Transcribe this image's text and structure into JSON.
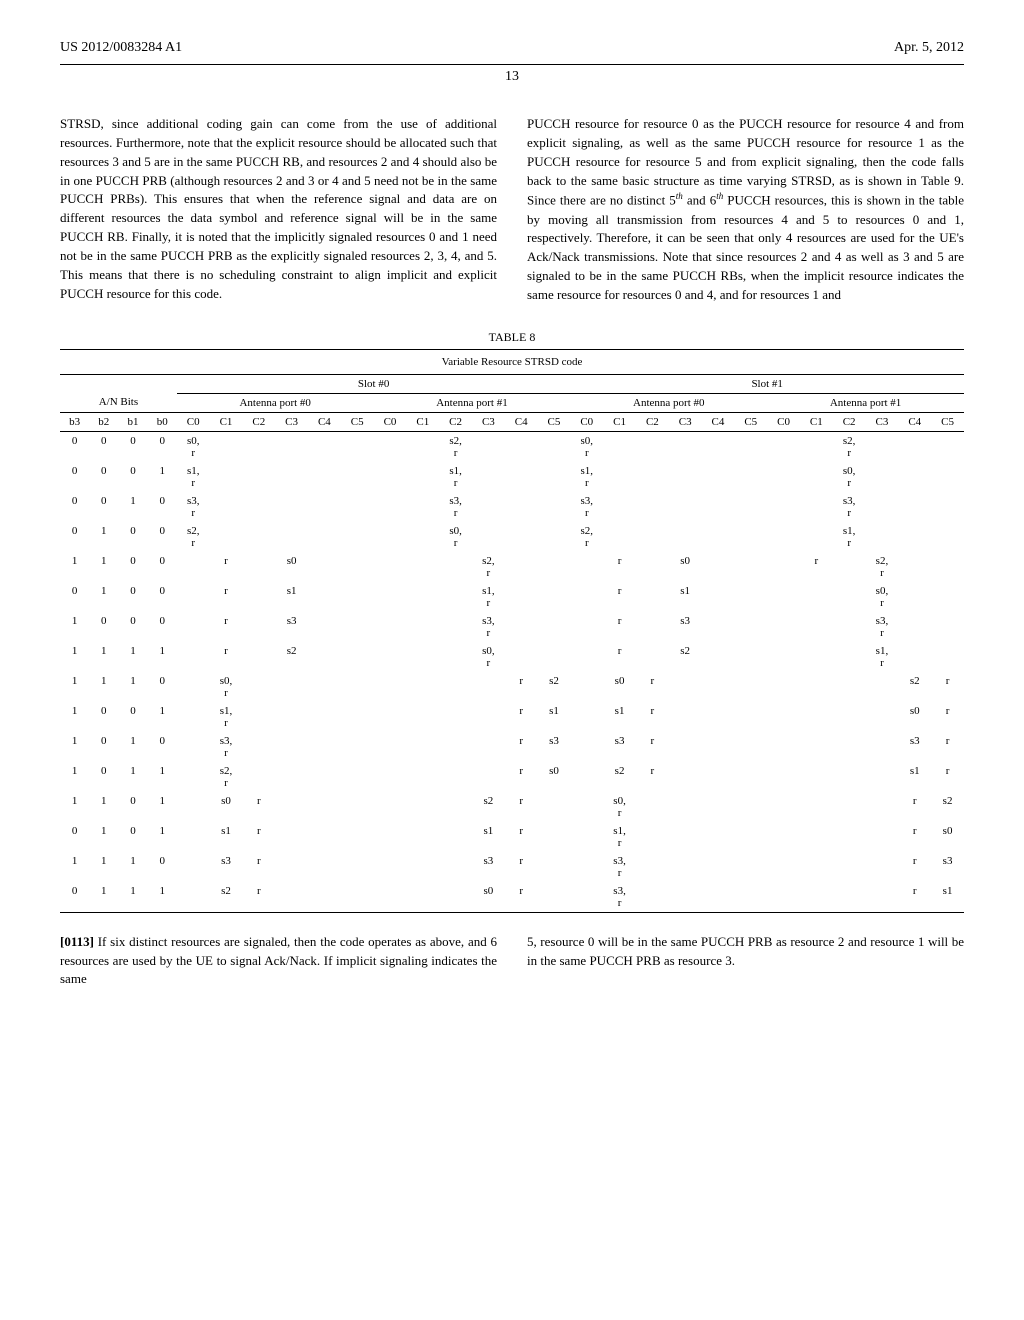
{
  "header": {
    "pub_number": "US 2012/0083284 A1",
    "date": "Apr. 5, 2012",
    "page": "13"
  },
  "chart_data": {
    "type": "table",
    "title": "Variable Resource STRSD code",
    "table_number": "TABLE 8",
    "column_headers": {
      "an_bits": "A/N Bits",
      "bits": [
        "b3",
        "b2",
        "b1",
        "b0"
      ],
      "slots": [
        "Slot #0",
        "Slot #1"
      ],
      "ports": [
        "Antenna port #0",
        "Antenna port #1"
      ],
      "channels": [
        "C0",
        "C1",
        "C2",
        "C3",
        "C4",
        "C5"
      ]
    },
    "rows": [
      {
        "bits": [
          "0",
          "0",
          "0",
          "0"
        ],
        "s0p0": [
          "s0, r",
          "",
          "",
          "",
          "",
          ""
        ],
        "s0p1": [
          "",
          "",
          "s2, r",
          "",
          "",
          ""
        ],
        "s1p0": [
          "s0, r",
          "",
          "",
          "",
          "",
          ""
        ],
        "s1p1": [
          "",
          "",
          "s2, r",
          "",
          "",
          ""
        ]
      },
      {
        "bits": [
          "0",
          "0",
          "0",
          "1"
        ],
        "s0p0": [
          "s1, r",
          "",
          "",
          "",
          "",
          ""
        ],
        "s0p1": [
          "",
          "",
          "s1, r",
          "",
          "",
          ""
        ],
        "s1p0": [
          "s1, r",
          "",
          "",
          "",
          "",
          ""
        ],
        "s1p1": [
          "",
          "",
          "s0, r",
          "",
          "",
          ""
        ]
      },
      {
        "bits": [
          "0",
          "0",
          "1",
          "0"
        ],
        "s0p0": [
          "s3, r",
          "",
          "",
          "",
          "",
          ""
        ],
        "s0p1": [
          "",
          "",
          "s3, r",
          "",
          "",
          ""
        ],
        "s1p0": [
          "s3, r",
          "",
          "",
          "",
          "",
          ""
        ],
        "s1p1": [
          "",
          "",
          "s3, r",
          "",
          "",
          ""
        ]
      },
      {
        "bits": [
          "0",
          "1",
          "0",
          "0"
        ],
        "s0p0": [
          "s2, r",
          "",
          "",
          "",
          "",
          ""
        ],
        "s0p1": [
          "",
          "",
          "s0, r",
          "",
          "",
          ""
        ],
        "s1p0": [
          "s2, r",
          "",
          "",
          "",
          "",
          ""
        ],
        "s1p1": [
          "",
          "",
          "s1, r",
          "",
          "",
          ""
        ]
      },
      {
        "bits": [
          "1",
          "1",
          "0",
          "0"
        ],
        "s0p0": [
          "",
          "r",
          "",
          "s0",
          "",
          ""
        ],
        "s0p1": [
          "",
          "",
          "",
          "s2, r",
          "",
          ""
        ],
        "s1p0": [
          "",
          "r",
          "",
          "s0",
          "",
          ""
        ],
        "s1p1": [
          "",
          "r",
          "",
          "s2, r",
          "",
          ""
        ]
      },
      {
        "bits": [
          "0",
          "1",
          "0",
          "0"
        ],
        "s0p0": [
          "",
          "r",
          "",
          "s1",
          "",
          ""
        ],
        "s0p1": [
          "",
          "",
          "",
          "s1, r",
          "",
          ""
        ],
        "s1p0": [
          "",
          "r",
          "",
          "s1",
          "",
          ""
        ],
        "s1p1": [
          "",
          "",
          "",
          "s0, r",
          "",
          ""
        ]
      },
      {
        "bits": [
          "1",
          "0",
          "0",
          "0"
        ],
        "s0p0": [
          "",
          "r",
          "",
          "s3",
          "",
          ""
        ],
        "s0p1": [
          "",
          "",
          "",
          "s3, r",
          "",
          ""
        ],
        "s1p0": [
          "",
          "r",
          "",
          "s3",
          "",
          ""
        ],
        "s1p1": [
          "",
          "",
          "",
          "s3, r",
          "",
          ""
        ]
      },
      {
        "bits": [
          "1",
          "1",
          "1",
          "1"
        ],
        "s0p0": [
          "",
          "r",
          "",
          "s2",
          "",
          ""
        ],
        "s0p1": [
          "",
          "",
          "",
          "s0, r",
          "",
          ""
        ],
        "s1p0": [
          "",
          "r",
          "",
          "s2",
          "",
          ""
        ],
        "s1p1": [
          "",
          "",
          "",
          "s1, r",
          "",
          ""
        ]
      },
      {
        "bits": [
          "1",
          "1",
          "1",
          "0"
        ],
        "s0p0": [
          "",
          "s0, r",
          "",
          "",
          "",
          ""
        ],
        "s0p1": [
          "",
          "",
          "",
          "",
          "r",
          "s2"
        ],
        "s1p0": [
          "",
          "s0",
          "r",
          "",
          "",
          ""
        ],
        "s1p1": [
          "",
          "",
          "",
          "",
          "s2",
          "r"
        ]
      },
      {
        "bits": [
          "1",
          "0",
          "0",
          "1"
        ],
        "s0p0": [
          "",
          "s1, r",
          "",
          "",
          "",
          ""
        ],
        "s0p1": [
          "",
          "",
          "",
          "",
          "r",
          "s1"
        ],
        "s1p0": [
          "",
          "s1",
          "r",
          "",
          "",
          ""
        ],
        "s1p1": [
          "",
          "",
          "",
          "",
          "s0",
          "r"
        ]
      },
      {
        "bits": [
          "1",
          "0",
          "1",
          "0"
        ],
        "s0p0": [
          "",
          "s3, r",
          "",
          "",
          "",
          ""
        ],
        "s0p1": [
          "",
          "",
          "",
          "",
          "r",
          "s3"
        ],
        "s1p0": [
          "",
          "s3",
          "r",
          "",
          "",
          ""
        ],
        "s1p1": [
          "",
          "",
          "",
          "",
          "s3",
          "r"
        ]
      },
      {
        "bits": [
          "1",
          "0",
          "1",
          "1"
        ],
        "s0p0": [
          "",
          "s2, r",
          "",
          "",
          "",
          ""
        ],
        "s0p1": [
          "",
          "",
          "",
          "",
          "r",
          "s0"
        ],
        "s1p0": [
          "",
          "s2",
          "r",
          "",
          "",
          ""
        ],
        "s1p1": [
          "",
          "",
          "",
          "",
          "s1",
          "r"
        ]
      },
      {
        "bits": [
          "1",
          "1",
          "0",
          "1"
        ],
        "s0p0": [
          "",
          "s0",
          "r",
          "",
          "",
          ""
        ],
        "s0p1": [
          "",
          "",
          "",
          "s2",
          "r",
          ""
        ],
        "s1p0": [
          "",
          "s0, r",
          "",
          "",
          "",
          ""
        ],
        "s1p1": [
          "",
          "",
          "",
          "",
          "r",
          "s2"
        ]
      },
      {
        "bits": [
          "0",
          "1",
          "0",
          "1"
        ],
        "s0p0": [
          "",
          "s1",
          "r",
          "",
          "",
          ""
        ],
        "s0p1": [
          "",
          "",
          "",
          "s1",
          "r",
          ""
        ],
        "s1p0": [
          "",
          "s1, r",
          "",
          "",
          "",
          ""
        ],
        "s1p1": [
          "",
          "",
          "",
          "",
          "r",
          "s0"
        ]
      },
      {
        "bits": [
          "1",
          "1",
          "1",
          "0"
        ],
        "s0p0": [
          "",
          "s3",
          "r",
          "",
          "",
          ""
        ],
        "s0p1": [
          "",
          "",
          "",
          "s3",
          "r",
          ""
        ],
        "s1p0": [
          "",
          "s3, r",
          "",
          "",
          "",
          ""
        ],
        "s1p1": [
          "",
          "",
          "",
          "",
          "r",
          "s3"
        ]
      },
      {
        "bits": [
          "0",
          "1",
          "1",
          "1"
        ],
        "s0p0": [
          "",
          "s2",
          "r",
          "",
          "",
          ""
        ],
        "s0p1": [
          "",
          "",
          "",
          "s0",
          "r",
          ""
        ],
        "s1p0": [
          "",
          "s3, r",
          "",
          "",
          "",
          ""
        ],
        "s1p1": [
          "",
          "",
          "",
          "",
          "r",
          "s1"
        ]
      }
    ]
  },
  "body": {
    "left_para": "STRSD, since additional coding gain can come from the use of additional resources. Furthermore, note that the explicit resource should be allocated such that resources 3 and 5 are in the same PUCCH RB, and resources 2 and 4 should also be in one PUCCH PRB (although resources 2 and 3 or 4 and 5 need not be in the same PUCCH PRBs). This ensures that when the reference signal and data are on different resources the data symbol and reference signal will be in the same PUCCH RB. Finally, it is noted that the implicitly signaled resources 0 and 1 need not be in the same PUCCH PRB as the explicitly signaled resources 2, 3, 4, and 5. This means that there is no scheduling constraint to align implicit and explicit PUCCH resource for this code.",
    "right_para_1": "PUCCH resource for resource 0 as the PUCCH resource for resource 4 and from explicit signaling, as well as the same PUCCH resource for resource 1 as the PUCCH resource for resource 5 and from explicit signaling, then the code falls back to the same basic structure as time varying STRSD, as is shown in Table 9. Since there are no distinct 5",
    "right_para_sup1": "th",
    "right_para_mid": " and 6",
    "right_para_sup2": "th",
    "right_para_2": " PUCCH resources, this is shown in the table by moving all transmission from resources 4 and 5 to resources 0 and 1, respectively. Therefore, it can be seen that only 4 resources are used for the UE's Ack/Nack transmissions. Note that since resources 2 and 4 as well as 3 and 5 are signaled to be in the same PUCCH RBs, when the implicit resource indicates the same resource for resources 0 and 4, and for resources 1 and"
  },
  "bottom": {
    "para_num": "[0113]",
    "left_text": "  If six distinct resources are signaled, then the code operates as above, and 6 resources are used by the UE to signal Ack/Nack. If implicit signaling indicates the same",
    "right_text": "5, resource 0 will be in the same PUCCH PRB as resource 2 and resource 1 will be in the same PUCCH PRB as resource 3."
  }
}
